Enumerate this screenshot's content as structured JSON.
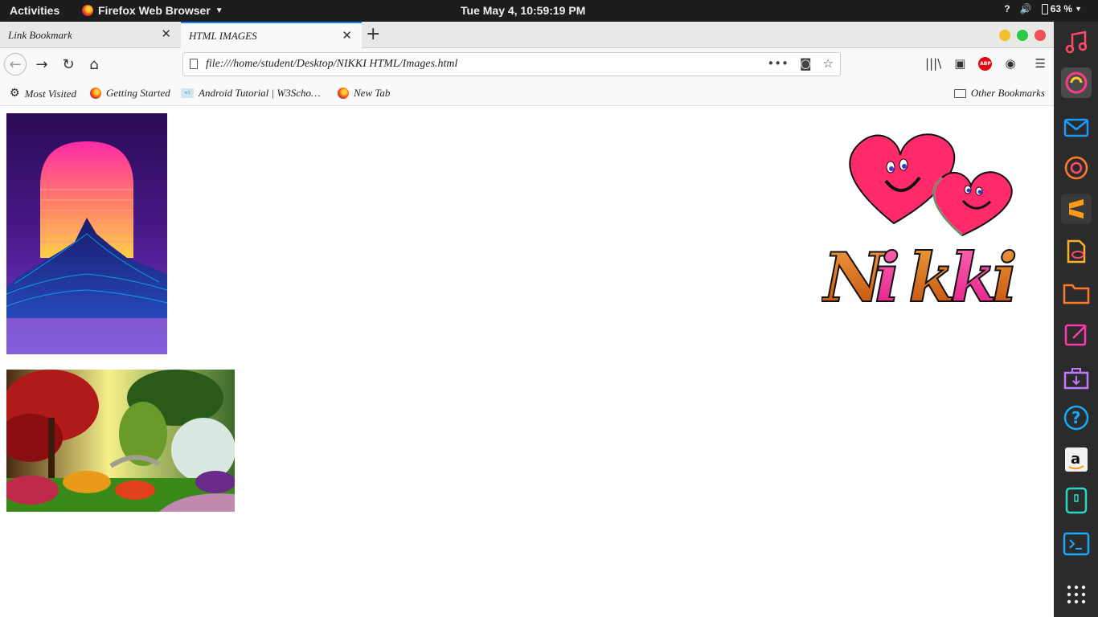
{
  "topbar": {
    "activities": "Activities",
    "app_name": "Firefox Web Browser",
    "clock": "Tue May  4, 10:59:19 PM",
    "tray_help": "?",
    "battery": "63 %"
  },
  "tabs": [
    {
      "title": "Link Bookmark",
      "active": false
    },
    {
      "title": "HTML IMAGES",
      "active": true
    }
  ],
  "url": "file:///home/student/Desktop/NIKKI HTML/Images.html",
  "bookmarks": [
    {
      "label": "Most Visited",
      "icon": "gear-icon"
    },
    {
      "label": "Getting Started",
      "icon": "firefox-icon"
    },
    {
      "label": "Android Tutorial | W3Scho…",
      "icon": "w3schools-icon"
    },
    {
      "label": "New Tab",
      "icon": "firefox-icon"
    }
  ],
  "other_bookmarks": "Other Bookmarks",
  "page": {
    "logo_text": "Nikki"
  },
  "dock": [
    "music-icon",
    "firefox-icon",
    "mail-icon",
    "aperture-icon",
    "sublime-icon",
    "document-viewer-icon",
    "files-icon",
    "text-editor-icon",
    "software-icon",
    "help-icon",
    "amazon-icon",
    "usb-icon",
    "terminal-icon",
    "apps-grid-icon"
  ],
  "colors": {
    "tab_accent": "#0a84ff",
    "topbar": "#1d1d1d",
    "dock": "#2b2b2b"
  }
}
